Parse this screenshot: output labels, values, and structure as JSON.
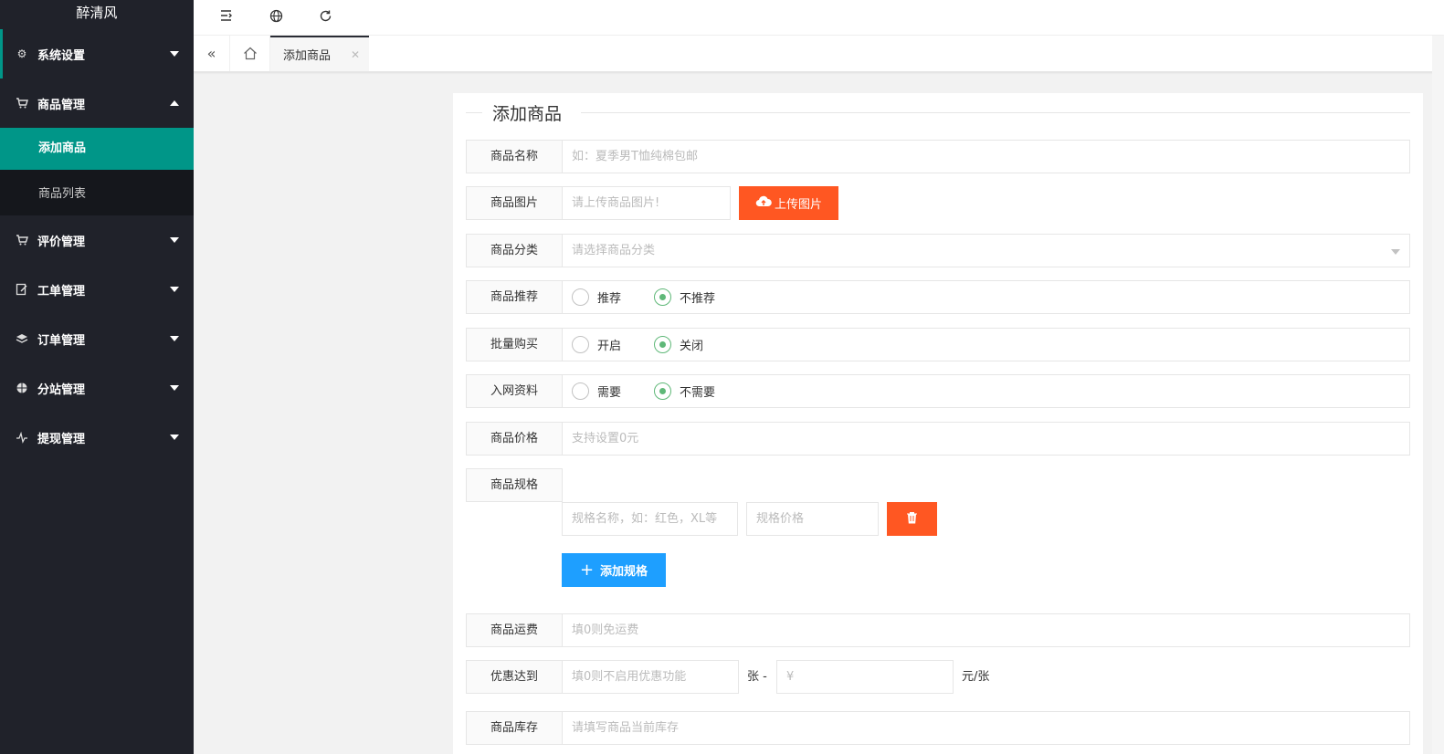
{
  "sidebar": {
    "logo": "醉清风",
    "items": [
      {
        "label": "系统设置",
        "icon": "gear-icon"
      },
      {
        "label": "商品管理",
        "icon": "cart-icon"
      },
      {
        "label": "评价管理",
        "icon": "cart-icon"
      },
      {
        "label": "工单管理",
        "icon": "edit-icon"
      },
      {
        "label": "订单管理",
        "icon": "layers-icon"
      },
      {
        "label": "分站管理",
        "icon": "globe-icon"
      },
      {
        "label": "提现管理",
        "icon": "pulse-icon"
      }
    ],
    "subitems": [
      {
        "label": "添加商品",
        "active": true
      },
      {
        "label": "商品列表",
        "active": false
      }
    ]
  },
  "header": {
    "icons": [
      "menu-collapse-icon",
      "globe-icon",
      "refresh-icon"
    ]
  },
  "tabs": {
    "items": [
      {
        "label": "添加商品",
        "active": true
      }
    ]
  },
  "form": {
    "title": "添加商品",
    "name": {
      "label": "商品名称",
      "placeholder": "如：夏季男T恤纯棉包邮"
    },
    "image": {
      "label": "商品图片",
      "placeholder": "请上传商品图片!",
      "upload_label": "上传图片"
    },
    "category": {
      "label": "商品分类",
      "placeholder": "请选择商品分类"
    },
    "recommend": {
      "label": "商品推荐",
      "options": [
        "推荐",
        "不推荐"
      ],
      "selected": "不推荐"
    },
    "bulk": {
      "label": "批量购买",
      "options": [
        "开启",
        "关闭"
      ],
      "selected": "关闭"
    },
    "network": {
      "label": "入网资料",
      "options": [
        "需要",
        "不需要"
      ],
      "selected": "不需要"
    },
    "price": {
      "label": "商品价格",
      "placeholder": "支持设置0元"
    },
    "spec": {
      "label": "商品规格",
      "name_placeholder": "规格名称，如：红色，XL等",
      "price_placeholder": "规格价格",
      "add_label": "添加规格"
    },
    "shipping": {
      "label": "商品运费",
      "placeholder": "填0则免运费"
    },
    "discount": {
      "label": "优惠达到",
      "count_placeholder": "填0则不启用优惠功能",
      "unit1": "张 -",
      "price_placeholder": "¥",
      "unit2": "元/张"
    },
    "stock": {
      "label": "商品库存",
      "placeholder": "请填写商品当前库存"
    }
  },
  "colors": {
    "sidebar_bg": "#20222a",
    "active_green": "#009688",
    "danger": "#ff5722",
    "primary": "#1e9fff",
    "radio_green": "#5fb878"
  }
}
